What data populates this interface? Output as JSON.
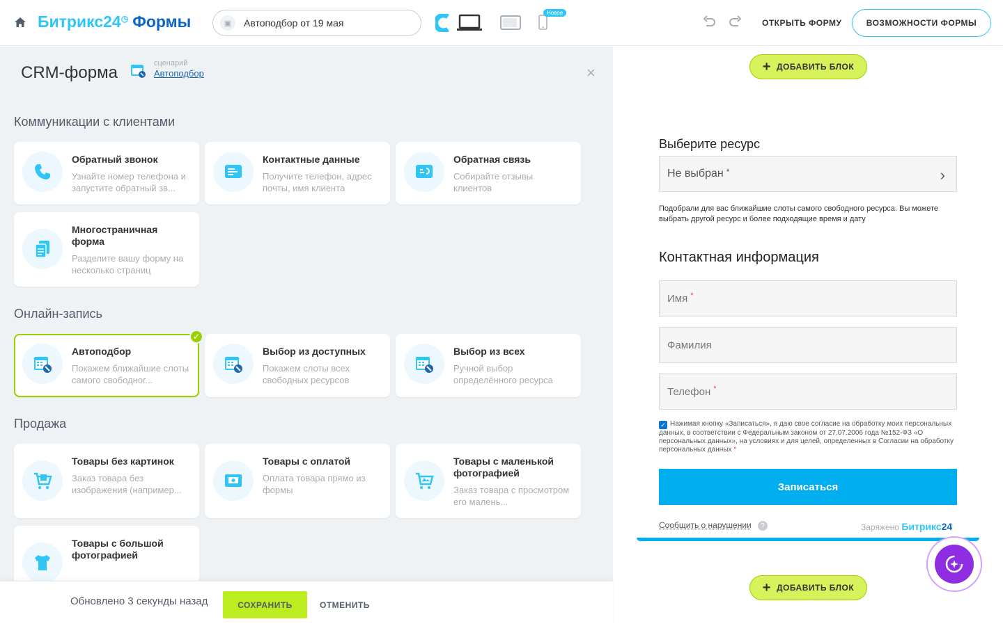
{
  "topbar": {
    "brand_name": "Битрикс24",
    "brand_product": "Формы",
    "form_title": "Автоподбор от 19 мая",
    "new_badge": "Новое",
    "open_form": "ОТКРЫТЬ ФОРМУ",
    "features": "ВОЗМОЖНОСТИ ФОРМЫ"
  },
  "panel": {
    "title": "CRM-форма",
    "scenario_label": "сценарий",
    "scenario_value": "Автоподбор",
    "sections": [
      {
        "title": "Коммуникации с клиентами",
        "cards": [
          {
            "title": "Обратный звонок",
            "desc": "Узнайте номер телефона и запустите обратный зв...",
            "icon": "phone-icon"
          },
          {
            "title": "Контактные данные",
            "desc": "Получите телефон, адрес почты, имя клиента",
            "icon": "contact-card-icon"
          },
          {
            "title": "Обратная связь",
            "desc": "Собирайте отзывы клиентов",
            "icon": "feedback-icon"
          },
          {
            "title": "Многостраничная форма",
            "desc": "Разделите вашу форму на несколько страниц",
            "icon": "pages-icon"
          }
        ]
      },
      {
        "title": "Онлайн-запись",
        "cards": [
          {
            "title": "Автоподбор",
            "desc": "Покажем ближайшие слоты самого свободног...",
            "icon": "calendar-icon",
            "selected": true
          },
          {
            "title": "Выбор из доступных",
            "desc": "Покажем слоты всех свободных ресурсов",
            "icon": "calendar-icon"
          },
          {
            "title": "Выбор из всех",
            "desc": "Ручной выбор определённого ресурса",
            "icon": "calendar-icon"
          }
        ]
      },
      {
        "title": "Продажа",
        "cards": [
          {
            "title": "Товары без картинок",
            "desc": "Заказ товара без изображения (например...",
            "icon": "cart-icon"
          },
          {
            "title": "Товары с оплатой",
            "desc": "Оплата товара прямо из формы",
            "icon": "payment-icon"
          },
          {
            "title": "Товары с маленькой фотографией",
            "desc": "Заказ товара с просмотром его малень...",
            "icon": "cart-photo-icon"
          },
          {
            "title": "Товары с большой фотографией",
            "desc": "",
            "icon": "tshirt-icon"
          }
        ]
      }
    ]
  },
  "bottom": {
    "updated": "Обновлено 3 секунды назад",
    "save": "СОХРАНИТЬ",
    "cancel": "ОТМЕНИТЬ"
  },
  "preview": {
    "add_block": "ДОБАВИТЬ БЛОК",
    "resource_heading": "Выберите ресурс",
    "resource_value": "Не выбран",
    "resource_required": "*",
    "resource_note": "Подобрали для вас ближайшие слоты самого свободного ресурса. Вы можете выбрать другой ресурс и более подходящие время и дату",
    "contact_heading": "Контактная информация",
    "fields": [
      {
        "label": "Имя",
        "required": true
      },
      {
        "label": "Фамилия",
        "required": false
      },
      {
        "label": "Телефон",
        "required": true
      }
    ],
    "consent": "Нажимая кнопку «Записаться», я даю свое согласие на обработку моих персональных данных, в соответствии с Федеральным законом от 27.07.2006 года №152-ФЗ «О персональных данных», на условиях и для целей, определенных в Согласии на обработку персональных данных",
    "consent_required": "*",
    "consent_checked": true,
    "submit": "Записаться",
    "report": "Сообщить о нарушении",
    "help": "?",
    "powered_label": "Заряжено",
    "powered_brand": "Битрикс",
    "powered_num": "24"
  },
  "colors": {
    "accent": "#2fc6f6",
    "brand_dark": "#0b66c3",
    "submit": "#00aeef",
    "save": "#bbed21",
    "selected_border": "#9dcf00",
    "assistant": "#8e2de2"
  }
}
